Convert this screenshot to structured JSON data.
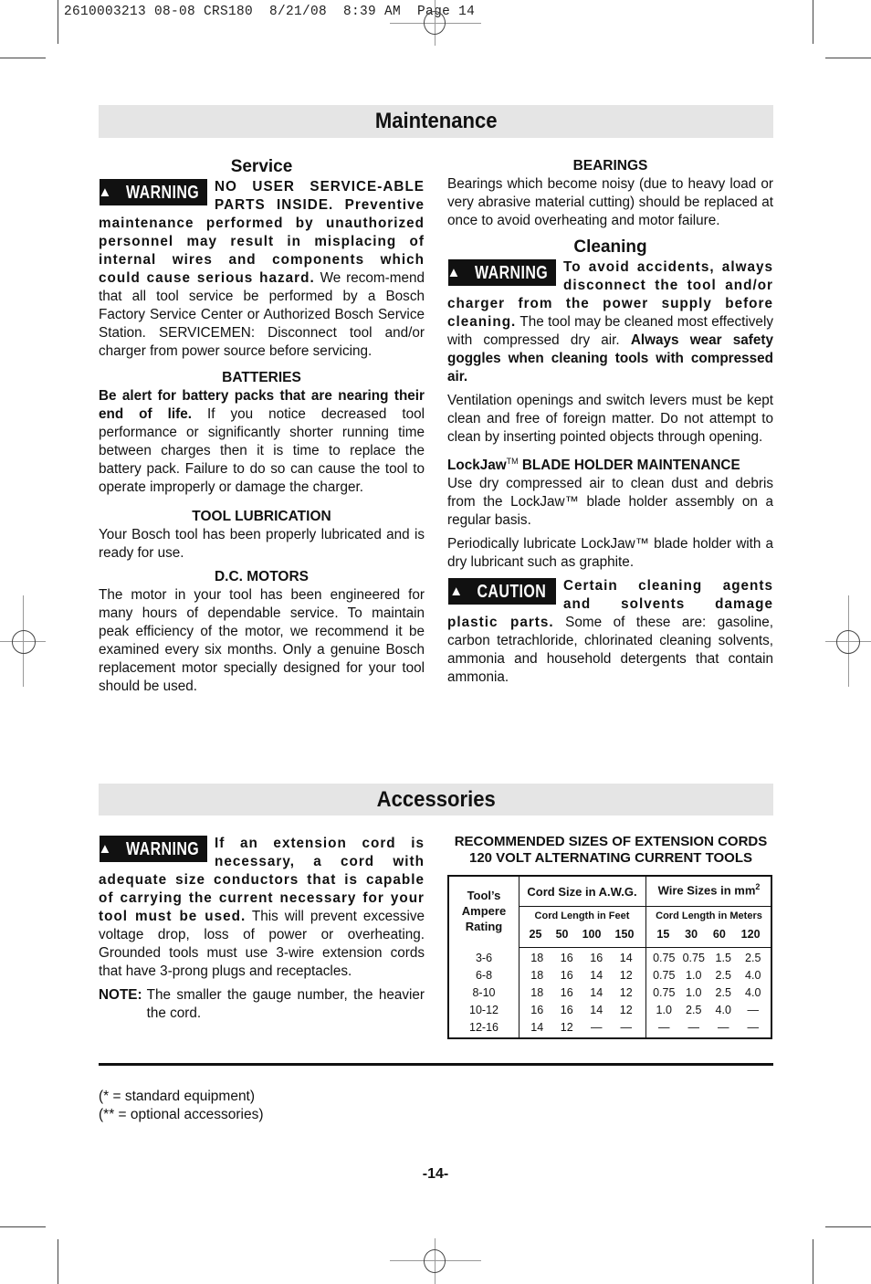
{
  "slug": "2610003213 08-08 CRS180  8/21/08  8:39 AM  Page 14",
  "maintenance": {
    "title": "Maintenance",
    "service": {
      "heading": "Service",
      "badge": "WARNING",
      "bold_lead": "NO USER SERVICE-ABLE PARTS INSIDE. Preventive maintenance performed by unauthorized personnel may result in misplacing of internal wires and components which could cause serious hazard.",
      "body": " We recom-mend that all tool service be performed by a Bosch Factory Service Center or Authorized Bosch Service Station. SERVICEMEN: Disconnect tool and/or charger from power source before servicing."
    },
    "batteries": {
      "heading": "BATTERIES",
      "bold_lead": "Be alert for battery packs that are nearing their end of life.",
      "body": "  If you notice decreased tool performance or significantly shorter running time between charges then it is time to replace the battery pack.  Failure to do so can cause the tool to operate improperly or damage the charger."
    },
    "lubrication": {
      "heading": "TOOL LUBRICATION",
      "body": "Your Bosch tool has been properly lubricated and is ready for use."
    },
    "motors": {
      "heading": "D.C. MOTORS",
      "body": "The motor in your tool has been engineered for many hours of dependable service. To maintain peak efficiency of the motor, we recommend it be examined every six months. Only a genuine Bosch replacement motor specially designed for your tool should be used."
    },
    "bearings": {
      "heading": "BEARINGS",
      "body": "Bearings which become noisy (due to heavy load or very abrasive material cutting) should be replaced at once to avoid overheating and motor failure."
    },
    "cleaning": {
      "heading": "Cleaning",
      "badge": "WARNING",
      "bold_lead": "To avoid accidents, always disconnect the tool and/or charger from the power supply before cleaning.",
      "body": " The tool may be cleaned most effectively with compressed dry air. ",
      "bold_tail": "Always wear safety goggles when cleaning tools with compressed air.",
      "ventilation": "Ventilation openings and switch levers must be kept clean and free of foreign matter. Do not attempt to clean by inserting pointed objects through opening.",
      "lockjaw_heading_a": "LockJaw",
      "lockjaw_tm": "TM",
      "lockjaw_heading_b": " BLADE HOLDER MAINTENANCE",
      "lockjaw_body": "Use dry compressed air to clean dust and debris from the LockJaw™ blade holder assembly on a regular basis.",
      "lubricate": "Periodically lubricate LockJaw™ blade holder with a dry lubricant such as graphite.",
      "caution_badge": "CAUTION",
      "caution_bold": "Certain cleaning agents and solvents damage plastic parts.",
      "caution_body": " Some of these are: gasoline, carbon tetrachloride, chlorinated cleaning solvents, ammonia and household detergents that contain ammonia."
    }
  },
  "accessories": {
    "title": "Accessories",
    "badge": "WARNING",
    "bold_lead": "If an extension cord is necessary, a cord with adequate size conductors that is capable of carrying the current necessary for your tool must be used.",
    "body": " This will prevent excessive voltage drop, loss of power or overheating.  Grounded tools must use 3-wire extension cords that have 3-prong plugs and receptacles.",
    "note_label": "NOTE:",
    "note_text": "The smaller the gauge number, the heavier the cord.",
    "table": {
      "title_line1": "RECOMMENDED SIZES OF EXTENSION CORDS",
      "title_line2": "120 VOLT ALTERNATING CURRENT TOOLS",
      "col_rating": [
        "Tool’s",
        "Ampere",
        "Rating"
      ],
      "awg_header": "Cord Size in A.W.G.",
      "mm_header": "Wire Sizes in mm",
      "mm_sup": "2",
      "feet_header": "Cord Length in Feet",
      "meters_header": "Cord Length in Meters",
      "feet": [
        "25",
        "50",
        "100",
        "150"
      ],
      "meters": [
        "15",
        "30",
        "60",
        "120"
      ],
      "rows": [
        {
          "rating": "3-6",
          "awg": [
            "18",
            "16",
            "16",
            "14"
          ],
          "mm": [
            "0.75",
            "0.75",
            "1.5",
            "2.5"
          ]
        },
        {
          "rating": "6-8",
          "awg": [
            "18",
            "16",
            "14",
            "12"
          ],
          "mm": [
            "0.75",
            "1.0",
            "2.5",
            "4.0"
          ]
        },
        {
          "rating": "8-10",
          "awg": [
            "18",
            "16",
            "14",
            "12"
          ],
          "mm": [
            "0.75",
            "1.0",
            "2.5",
            "4.0"
          ]
        },
        {
          "rating": "10-12",
          "awg": [
            "16",
            "16",
            "14",
            "12"
          ],
          "mm": [
            "1.0",
            "2.5",
            "4.0",
            "—"
          ]
        },
        {
          "rating": "12-16",
          "awg": [
            "14",
            "12",
            "—",
            "—"
          ],
          "mm": [
            "—",
            "—",
            "—",
            "—"
          ]
        }
      ]
    }
  },
  "footnotes": [
    "(* = standard equipment)",
    "(** = optional accessories)"
  ],
  "page_number": "-14-"
}
